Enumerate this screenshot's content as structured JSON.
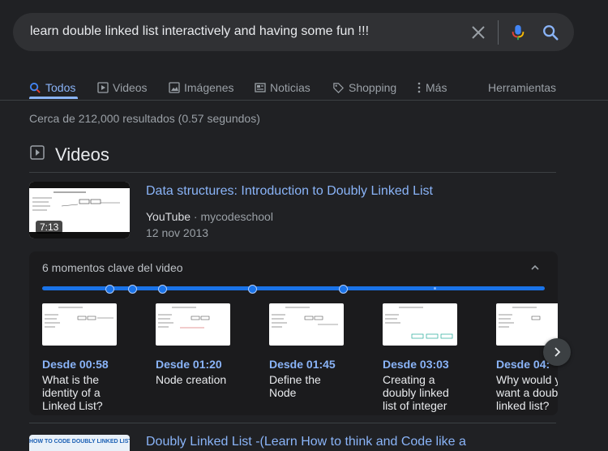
{
  "search": {
    "query": "learn double linked list interactively and having some fun !!!",
    "icons": [
      "close-icon",
      "microphone-icon",
      "search-icon"
    ],
    "mic_colors": [
      "#4285f4",
      "#ea4335",
      "#fbbc04",
      "#34a853"
    ],
    "search_icon_color": "#8ab4f8"
  },
  "tabs": [
    {
      "label": "Todos",
      "icon": "search-icon",
      "active": true
    },
    {
      "label": "Videos",
      "icon": "play-icon"
    },
    {
      "label": "Imágenes",
      "icon": "image-icon"
    },
    {
      "label": "Noticias",
      "icon": "news-icon"
    },
    {
      "label": "Shopping",
      "icon": "tag-icon"
    },
    {
      "label": "Más",
      "icon": "more-vertical-icon"
    }
  ],
  "tools_label": "Herramientas",
  "results_stats": "Cerca de 212,000 resultados (0.57 segundos)",
  "videos_section": {
    "title": "Videos",
    "icon": "video-play-icon",
    "result1": {
      "title": "Data structures: Introduction to Doubly Linked List",
      "source": "YouTube",
      "channel": "mycodeschool",
      "date": "12 nov 2013",
      "duration": "7:13",
      "key_moments": {
        "title": "6 momentos clave del video",
        "progress_markers": [
          0.135,
          0.18,
          0.24,
          0.42,
          0.6,
          0.78
        ],
        "moments": [
          {
            "time": "Desde 00:58",
            "label": "What is the identity of a Linked List?"
          },
          {
            "time": "Desde 01:20",
            "label": "Node creation"
          },
          {
            "time": "Desde 01:45",
            "label": "Define the Node"
          },
          {
            "time": "Desde 03:03",
            "label": "Creating a doubly linked list of integer"
          },
          {
            "time": "Desde 04:",
            "label": "Why would you want a doubly linked list?"
          }
        ]
      }
    },
    "result2": {
      "title": "Doubly Linked List -(Learn How to think and Code like a",
      "thumb_text": "HOW TO CODE DOUBLY LINKED LIST"
    }
  },
  "colors": {
    "accent": "#8ab4f8",
    "background": "#202124",
    "track": "#1a73e8"
  }
}
